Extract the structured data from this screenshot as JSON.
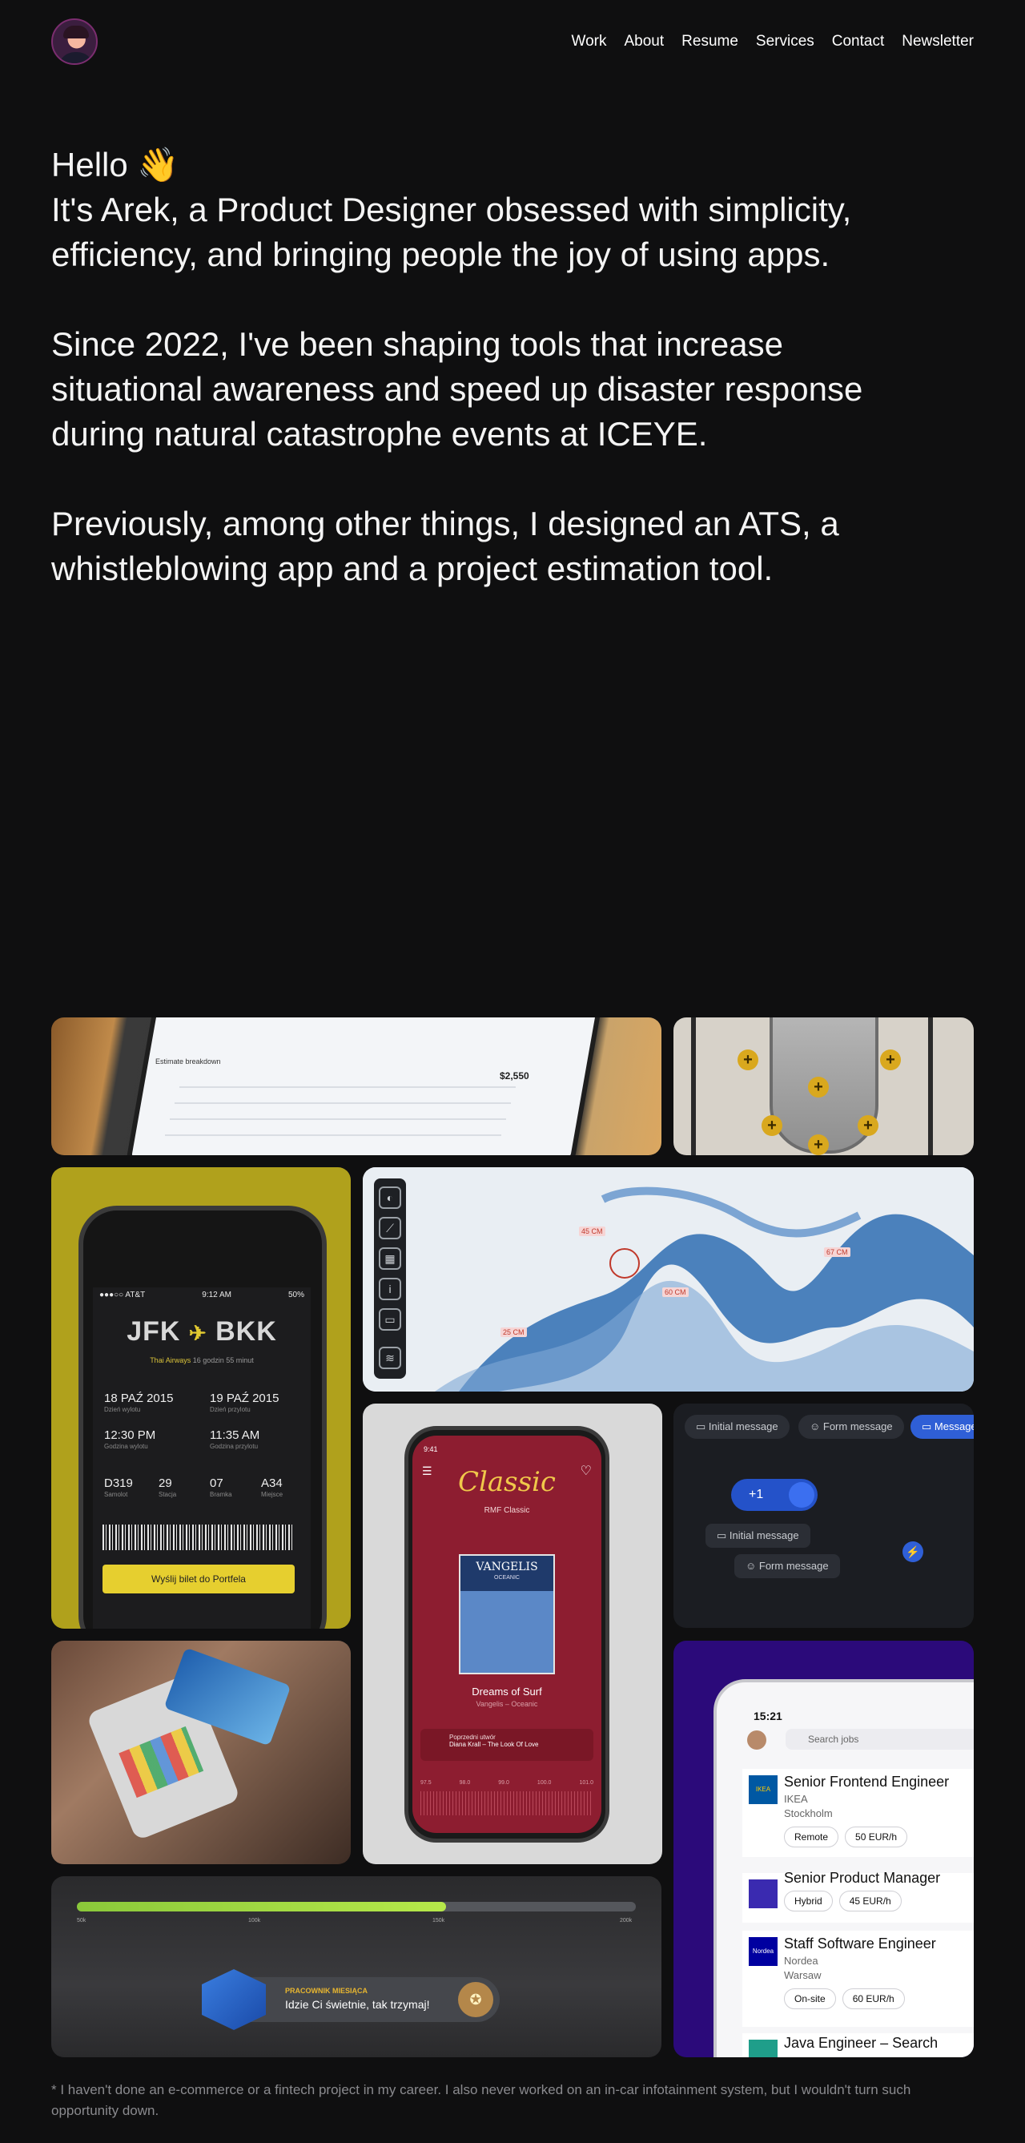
{
  "nav": {
    "items": [
      "Work",
      "About",
      "Resume",
      "Services",
      "Contact",
      "Newsletter"
    ]
  },
  "intro": {
    "hello": "Hello 👋",
    "p1": "It's Arek, a Product Designer obsessed with simplicity, efficiency, and bringing people the joy of using apps.",
    "p2": "Since 2022, I've been shaping tools that increase situational awareness and speed up disaster response during natural catastrophe events at ICEYE.",
    "p3": "Previously, among other things, I designed an ATS, a whistleblowing app and a project estimation tool."
  },
  "estimation": {
    "title": "Estimate breakdown",
    "price": "$2,550"
  },
  "boarding": {
    "status_left": "●●●○○ AT&T",
    "status_time": "9:12 AM",
    "status_right": "50%",
    "from": "JFK",
    "to": "BKK",
    "airline": "Thai Airways",
    "duration": "16 godzin 55 minut",
    "date_out": "18 PAŹ 2015",
    "date_out_label": "Dzień wylotu",
    "date_in": "19 PAŹ 2015",
    "date_in_label": "Dzień przylotu",
    "time_out": "12:30 PM",
    "time_out_label": "Godzina wylotu",
    "time_in": "11:35 AM",
    "time_in_label": "Godzina przylotu",
    "flight": "D319",
    "flight_label": "Samolot",
    "gate1": "29",
    "gate1_label": "Stacja",
    "gate2": "07",
    "gate2_label": "Bramka",
    "seat": "A34",
    "seat_label": "Miejsce",
    "button": "Wyślij bilet do Portfela"
  },
  "map": {
    "labels": [
      "45 CM",
      "60 CM",
      "67 CM",
      "25 CM"
    ]
  },
  "radio": {
    "time": "9:41",
    "logo": "Classic",
    "station": "RMF Classic",
    "cover_title": "VANGELIS",
    "cover_sub": "OCEANIC",
    "song": "Dreams of Surf",
    "artist": "Vangelis – Oceanic",
    "prev_label": "Poprzedni utwór",
    "prev_track": "Diana Krall – The Look Of Love",
    "freqs": [
      "97.5",
      "98.0",
      "99.0",
      "100.0",
      "101.0"
    ]
  },
  "messages": {
    "chips": [
      "Initial message",
      "Form message",
      "Message"
    ],
    "count": "+1",
    "node1": "Initial message",
    "node2": "Form message"
  },
  "jobs": {
    "time": "15:21",
    "search_placeholder": "Search jobs",
    "items": [
      {
        "logo": "IKEA",
        "title": "Senior Frontend Engineer",
        "company": "IKEA",
        "location": "Stockholm",
        "tags": [
          "Remote",
          "50 EUR/h"
        ]
      },
      {
        "logo": "",
        "title": "Senior Product Manager",
        "company": "",
        "location": "",
        "tags": [
          "Hybrid",
          "45 EUR/h"
        ]
      },
      {
        "logo": "Nordea",
        "title": "Staff Software Engineer",
        "company": "Nordea",
        "location": "Warsaw",
        "tags": [
          "On-site",
          "60 EUR/h"
        ]
      },
      {
        "logo": "",
        "title": "Java Engineer – Search",
        "company": "",
        "location": "",
        "tags": []
      }
    ]
  },
  "progress": {
    "value_fraction": 0.66,
    "ticks": [
      "50k",
      "100k",
      "150k",
      "200k"
    ],
    "badge_title": "PRACOWNIK MIESIĄCA",
    "badge_message": "Idzie Ci świetnie, tak trzymaj!"
  },
  "footnote": "* I haven't done an e-commerce or a fintech project in my career. I also never worked on an in-car infotainment system, but I wouldn't turn such opportunity down.",
  "colors": {
    "background": "#0f0f10",
    "accent_blue": "#2f5fd6",
    "boarding_yellow": "#b0a11c",
    "radio_red": "#8d1d30",
    "jobs_purple": "#2b0a7a",
    "progress_green": "#8ac83a"
  }
}
